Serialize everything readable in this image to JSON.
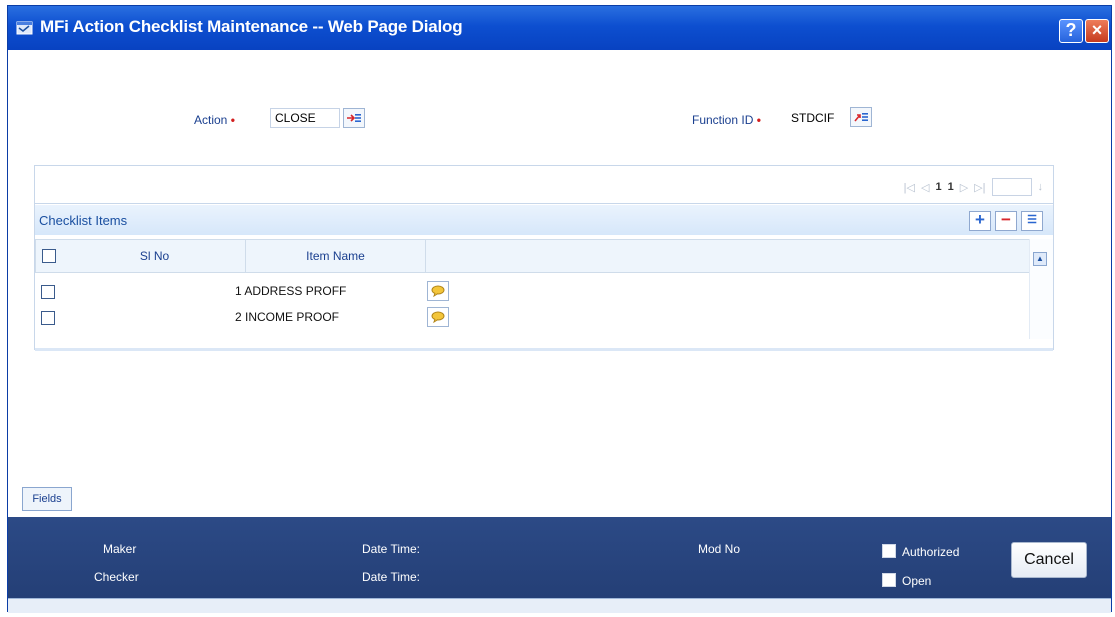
{
  "window": {
    "title": "MFi Action Checklist Maintenance -- Web Page Dialog",
    "help_label": "?",
    "close_label": "×"
  },
  "header": {
    "action_label": "Action",
    "action_value": "CLOSE",
    "function_id_label": "Function ID",
    "function_id_value": "STDCIF",
    "required_mark": "•"
  },
  "pager": {
    "current_page": "1",
    "total_pages": "1"
  },
  "checklist": {
    "title": "Checklist Items",
    "columns": [
      "Sl No",
      "Item Name"
    ],
    "rows": [
      {
        "item": "1 ADDRESS PROFF"
      },
      {
        "item": "2 INCOME PROOF"
      }
    ]
  },
  "tabs": {
    "fields_label": "Fields"
  },
  "footer": {
    "maker_label": "Maker",
    "checker_label": "Checker",
    "date_time_label": "Date Time:",
    "mod_no_label": "Mod No",
    "authorized_label": "Authorized",
    "open_label": "Open",
    "cancel_label": "Cancel"
  },
  "colors": {
    "title_bar": "#0d4fd0",
    "footer": "#2c4a86",
    "required": "#d21f1f"
  }
}
